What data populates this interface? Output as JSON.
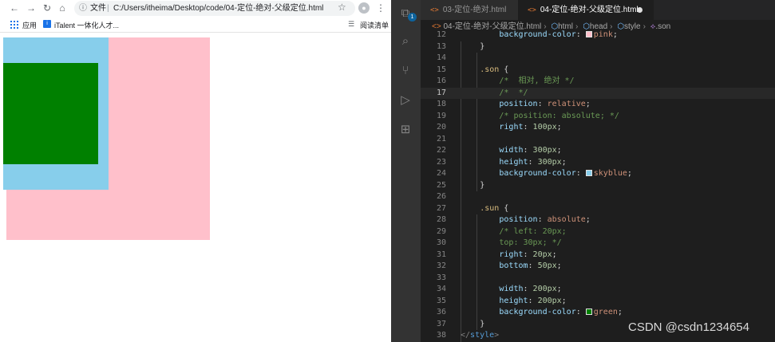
{
  "browser": {
    "address_prefix": "文件",
    "address_separator": "|",
    "url": "C:/Users/itheima/Desktop/code/04-定位-绝对-父级定位.html",
    "bookmarks": [
      {
        "label": "应用"
      },
      {
        "label": "iTalent 一体化人才..."
      }
    ],
    "reading_list": "阅读清单",
    "content": {
      "father_color": "#ffc0cb",
      "son_color": "#87ceeb",
      "sun_color": "#008000"
    }
  },
  "vscode": {
    "files_badge": "1",
    "tabs": [
      {
        "label": "03-定位-绝对.html",
        "active": false
      },
      {
        "label": "04-定位-绝对-父级定位.html",
        "active": true,
        "modified": true
      }
    ],
    "breadcrumb": [
      "04-定位-绝对-父级定位.html",
      "html",
      "head",
      "style",
      ".son"
    ],
    "lines": [
      {
        "n": "12",
        "prop": "background-color",
        "val": "pink"
      },
      {
        "n": "13",
        "text": "}"
      },
      {
        "n": "14",
        "text": ""
      },
      {
        "n": "15",
        "selector": ".son",
        "text": " {"
      },
      {
        "n": "16",
        "comment": "/*  相对, 绝对 */"
      },
      {
        "n": "17",
        "comment": "/*  */"
      },
      {
        "n": "18",
        "prop": "position",
        "val": "relative"
      },
      {
        "n": "19",
        "comment": "/* position: absolute; */"
      },
      {
        "n": "20",
        "prop": "right",
        "num": "100px"
      },
      {
        "n": "21",
        "text": ""
      },
      {
        "n": "22",
        "prop": "width",
        "num": "300px"
      },
      {
        "n": "23",
        "prop": "height",
        "num": "300px"
      },
      {
        "n": "24",
        "prop": "background-color",
        "val": "skyblue"
      },
      {
        "n": "25",
        "text": "}"
      },
      {
        "n": "26",
        "text": ""
      },
      {
        "n": "27",
        "selector": ".sun",
        "text": " {"
      },
      {
        "n": "28",
        "prop": "position",
        "val": "absolute"
      },
      {
        "n": "29",
        "comment": "/* left: 20px;"
      },
      {
        "n": "30",
        "comment": "top: 30px; */"
      },
      {
        "n": "31",
        "prop": "right",
        "num": "20px"
      },
      {
        "n": "32",
        "prop": "bottom",
        "num": "50px"
      },
      {
        "n": "33",
        "text": ""
      },
      {
        "n": "34",
        "prop": "width",
        "num": "200px"
      },
      {
        "n": "35",
        "prop": "height",
        "num": "200px"
      },
      {
        "n": "36",
        "prop": "background-color",
        "val": "green"
      },
      {
        "n": "37",
        "text": "}"
      },
      {
        "n": "38",
        "closing_tag": "style"
      }
    ],
    "swatch_colors": {
      "pink": "#ffc0cb",
      "skyblue": "#87ceeb",
      "green": "#008000"
    }
  },
  "watermark": "CSDN @csdn1234654"
}
